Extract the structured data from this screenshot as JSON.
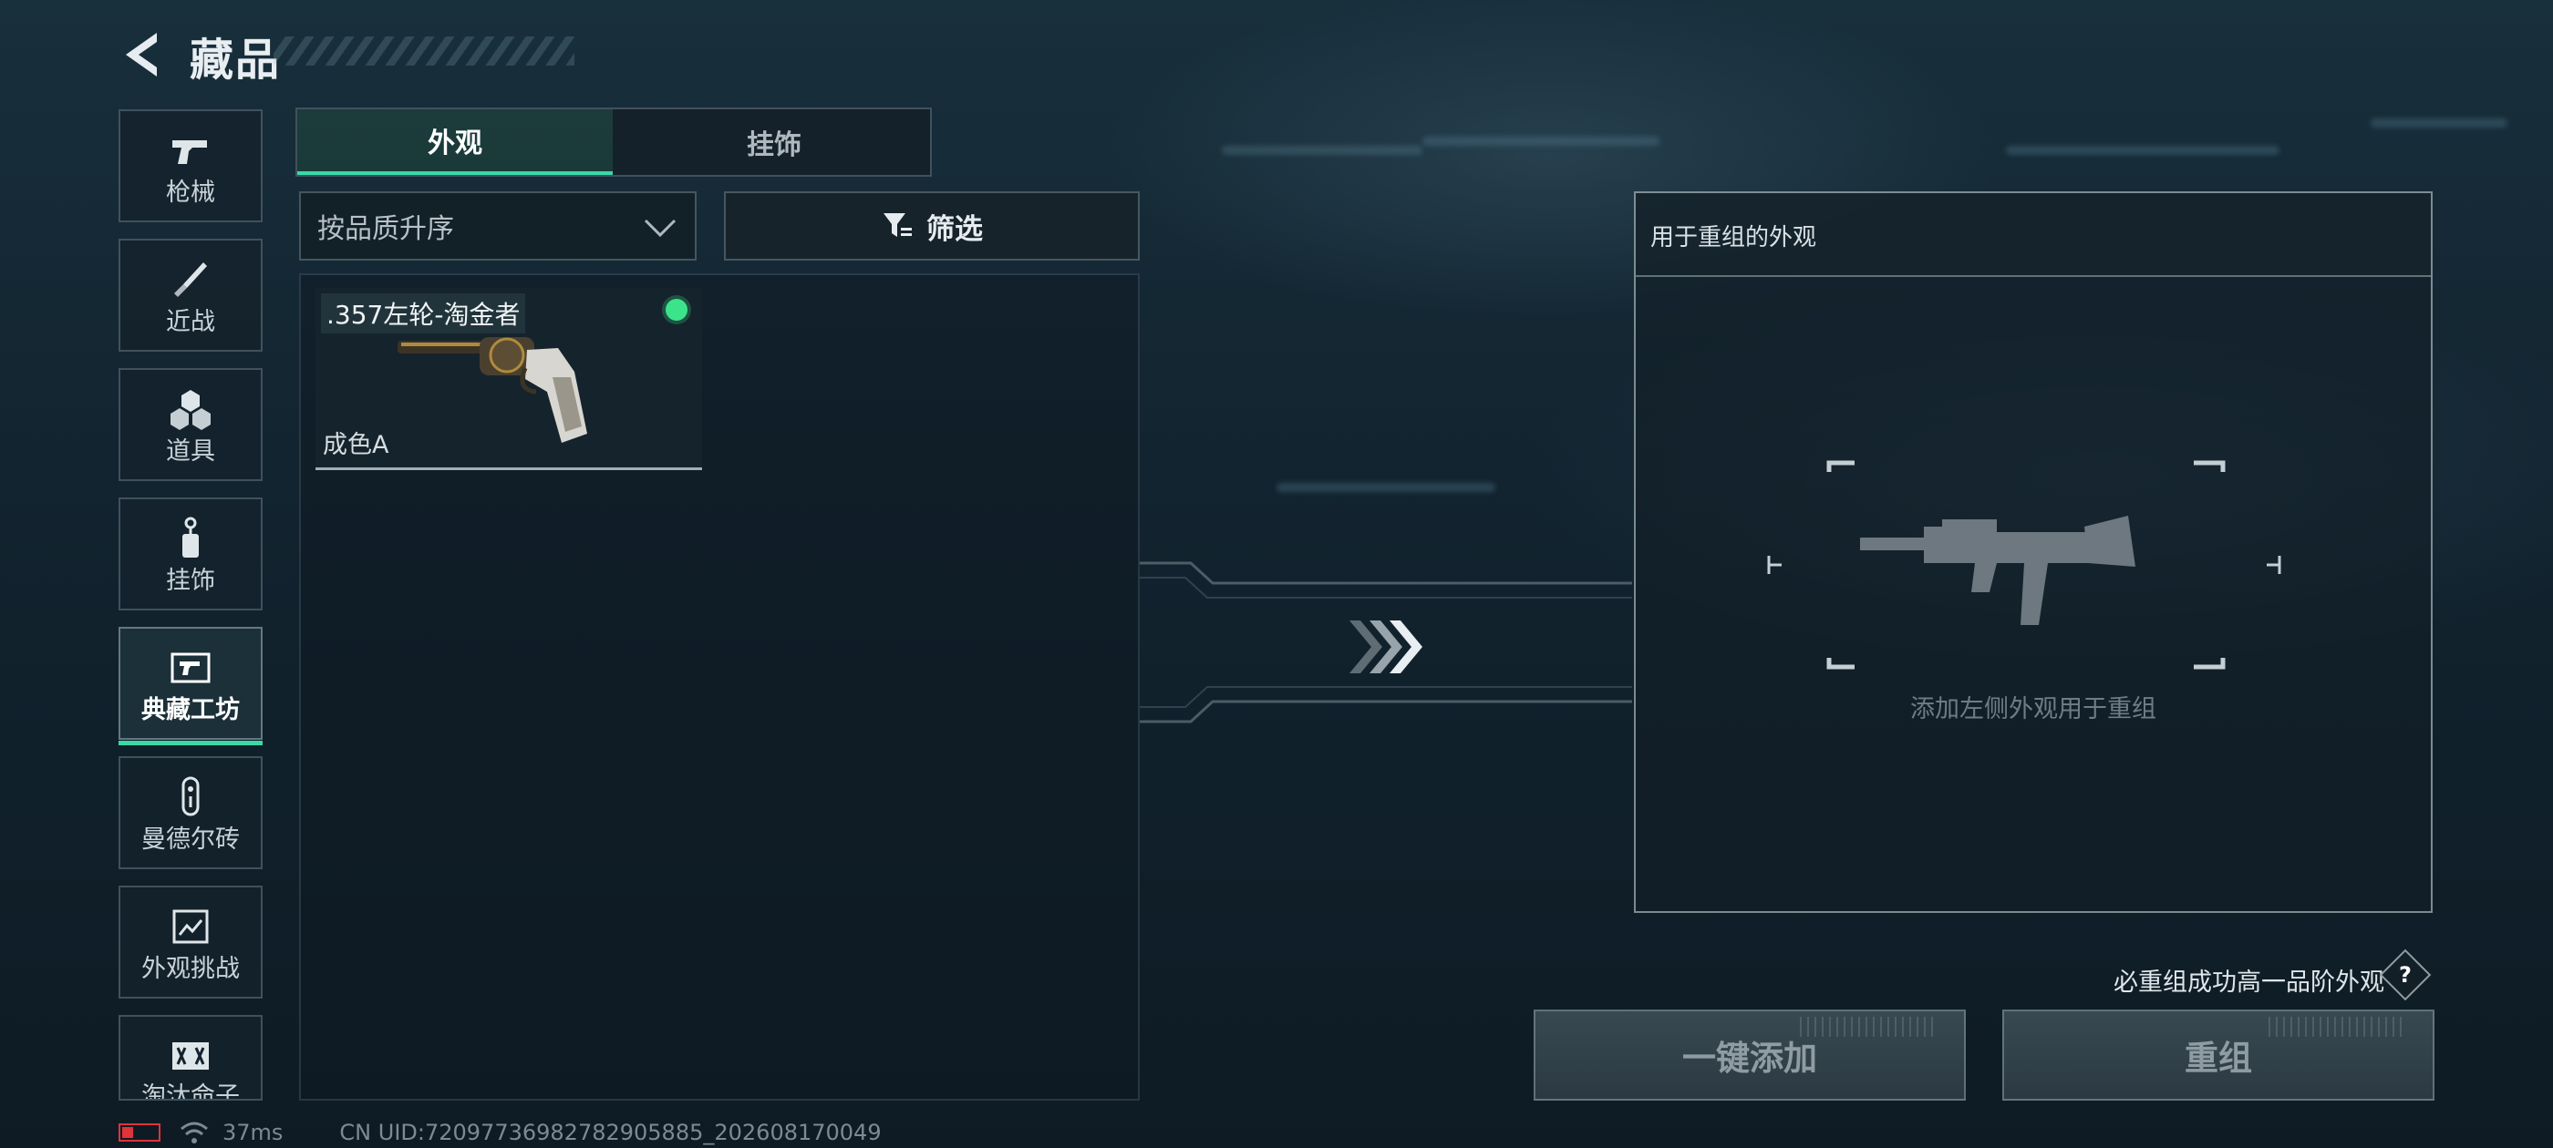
{
  "header": {
    "title": "藏品"
  },
  "sidebar": {
    "items": [
      {
        "label": "枪械",
        "icon": "pistol-icon"
      },
      {
        "label": "近战",
        "icon": "knife-icon"
      },
      {
        "label": "道具",
        "icon": "grenades-icon"
      },
      {
        "label": "挂饰",
        "icon": "charm-icon"
      },
      {
        "label": "典藏工坊",
        "icon": "workshop-icon",
        "active": true
      },
      {
        "label": "曼德尔砖",
        "icon": "brick-icon"
      },
      {
        "label": "外观挑战",
        "icon": "challenge-icon"
      },
      {
        "label": "淘汰命子",
        "icon": "elimination-icon"
      }
    ]
  },
  "tabs": [
    {
      "label": "外观",
      "active": true
    },
    {
      "label": "挂饰",
      "active": false
    }
  ],
  "sort": {
    "selected": "按品质升序"
  },
  "filter": {
    "label": "筛选"
  },
  "items": [
    {
      "name": ".357左轮-淘金者",
      "grade": "成色A",
      "owned": true
    }
  ],
  "recombine": {
    "title": "用于重组的外观",
    "empty_hint": "添加左侧外观用于重组"
  },
  "guarantee": {
    "text": "必重组成功高一品阶外观",
    "help": "?"
  },
  "buttons": {
    "quick_add": "一键添加",
    "recombine": "重组"
  },
  "status": {
    "ping": "37ms",
    "uid": "CN UID:7209773698278290588​5_202608170049"
  },
  "colors": {
    "accent": "#39d9a8",
    "owned_dot": "#3ce38a",
    "battery": "#e0333a",
    "background": "#0f1c25"
  }
}
